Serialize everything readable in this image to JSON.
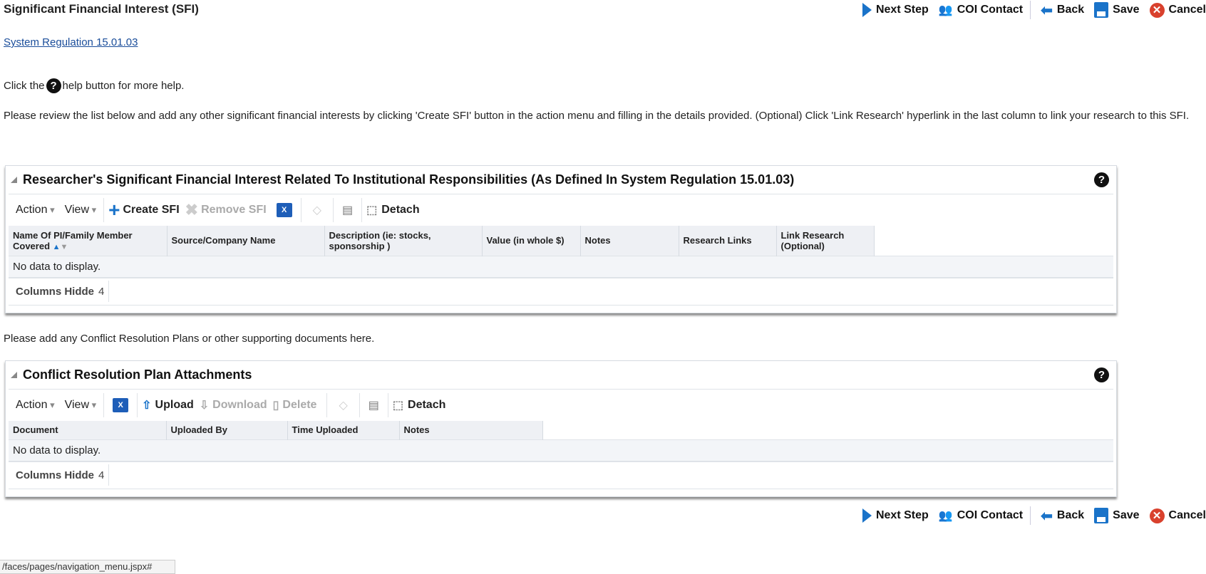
{
  "page": {
    "title": "Significant Financial Interest (SFI)",
    "regulation_link": "System Regulation 15.01.03",
    "help_prefix": "Click the",
    "help_suffix": "help button for more help.",
    "instructions": "Please review the list below and add any other significant financial interests by clicking 'Create SFI' button in the action menu and filling in the details provided. (Optional) Click 'Link Research' hyperlink in the last column to link your research to this SFI.",
    "attachments_prompt": "Please add any Conflict Resolution Plans or other supporting documents here.",
    "status_url": "/faces/pages/navigation_menu.jspx#"
  },
  "nav": {
    "next": "Next Step",
    "coi": "COI Contact",
    "back": "Back",
    "save": "Save",
    "cancel": "Cancel"
  },
  "sfi": {
    "title": "Researcher's Significant Financial Interest Related To Institutional Responsibilities (As Defined In System Regulation 15.01.03)",
    "action": "Action",
    "view": "View",
    "create": "Create SFI",
    "remove": "Remove SFI",
    "detach": "Detach",
    "columns": [
      "Name Of PI/Family Member Covered",
      "Source/Company Name",
      "Description (ie: stocks, sponsorship )",
      "Value (in whole $)",
      "Notes",
      "Research Links",
      "Link Research (Optional)"
    ],
    "empty": "No data to display.",
    "hidden_label": "Columns Hidde",
    "hidden_count": "4"
  },
  "attach": {
    "title": "Conflict Resolution Plan Attachments",
    "action": "Action",
    "view": "View",
    "upload": "Upload",
    "download": "Download",
    "delete": "Delete",
    "detach": "Detach",
    "columns": [
      "Document",
      "Uploaded By",
      "Time Uploaded",
      "Notes"
    ],
    "empty": "No data to display.",
    "hidden_label": "Columns Hidde",
    "hidden_count": "4"
  },
  "colors": {
    "accent": "#1a73c9",
    "cancel": "#d9412d"
  }
}
